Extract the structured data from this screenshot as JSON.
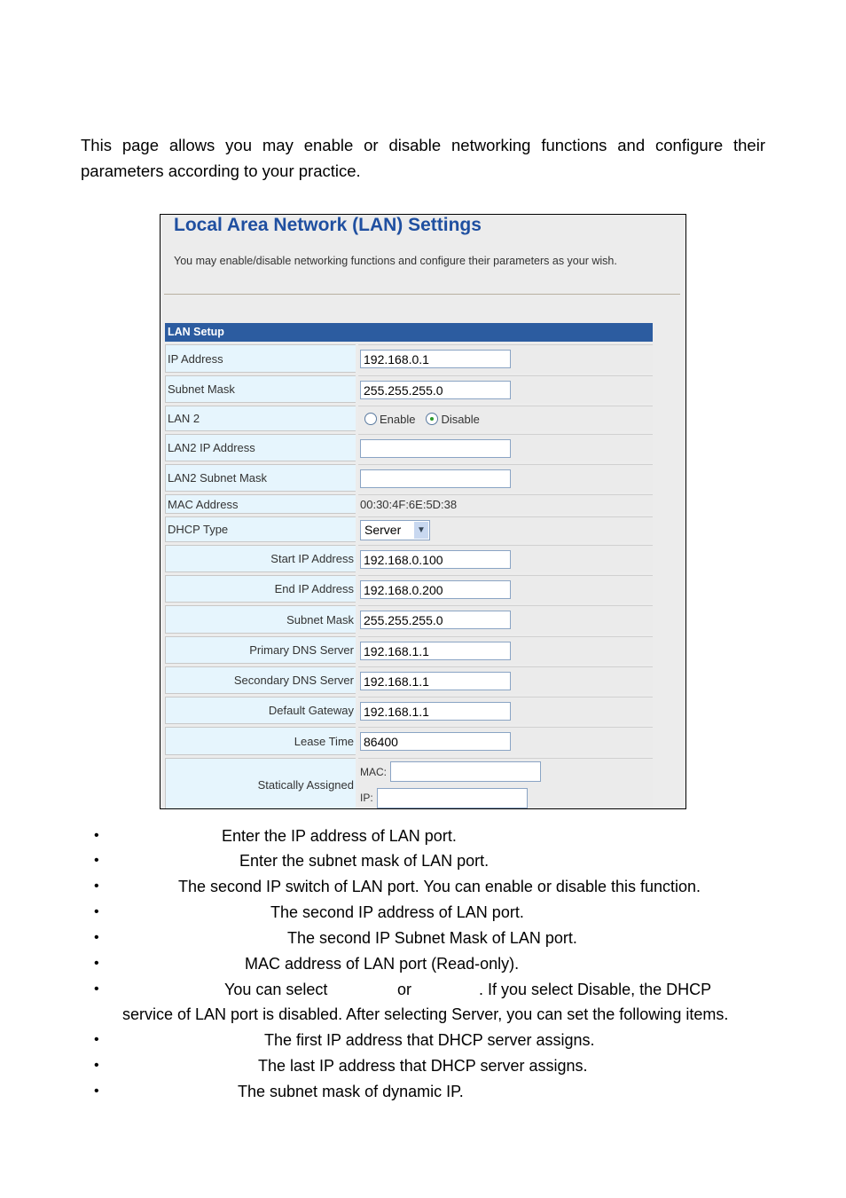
{
  "intro": "This page allows you may enable or disable networking functions and configure their parameters according to your practice.",
  "screen": {
    "title": "Local Area Network (LAN) Settings",
    "subtitle": "You may enable/disable networking functions and configure their parameters as your wish.",
    "section": "LAN Setup",
    "ip_label": "IP Address",
    "ip": "192.168.0.1",
    "mask_label": "Subnet Mask",
    "mask": "255.255.255.0",
    "lan2_label": "LAN 2",
    "enable": "Enable",
    "disable": "Disable",
    "lan2_selected": "Disable",
    "lan2ip_label": "LAN2 IP Address",
    "lan2ip": "",
    "lan2mask_label": "LAN2 Subnet Mask",
    "lan2mask": "",
    "mac_label": "MAC Address",
    "mac": "00:30:4F:6E:5D:38",
    "dhcp_label": "DHCP Type",
    "dhcp": "Server",
    "start_label": "Start IP Address",
    "start": "192.168.0.100",
    "end_label": "End IP Address",
    "end": "192.168.0.200",
    "dmask_label": "Subnet Mask",
    "dmask": "255.255.255.0",
    "pdns_label": "Primary DNS Server",
    "pdns": "192.168.1.1",
    "sdns_label": "Secondary DNS Server",
    "sdns": "192.168.1.1",
    "gw_label": "Default Gateway",
    "gw": "192.168.1.1",
    "lease_label": "Lease Time",
    "lease": "86400",
    "static_label": "Statically Assigned",
    "static_mac_label": "MAC:",
    "static_ip_label": "IP:"
  },
  "bullets": [
    "Enter the IP address of LAN port.",
    "Enter the subnet mask of LAN port.",
    "The second IP switch of LAN port. You can enable or disable this function.",
    "The second IP address of LAN port.",
    "The second IP Subnet Mask of LAN port.",
    "MAC address of LAN port (Read-only).",
    "You can select",
    "or",
    ". If you select Disable, the DHCP",
    "service of LAN port is disabled. After selecting Server, you can set the following items.",
    "The first IP address that DHCP server assigns.",
    "The last IP address that DHCP server assigns.",
    "The subnet mask of dynamic IP."
  ],
  "bullet_glyph": "•"
}
